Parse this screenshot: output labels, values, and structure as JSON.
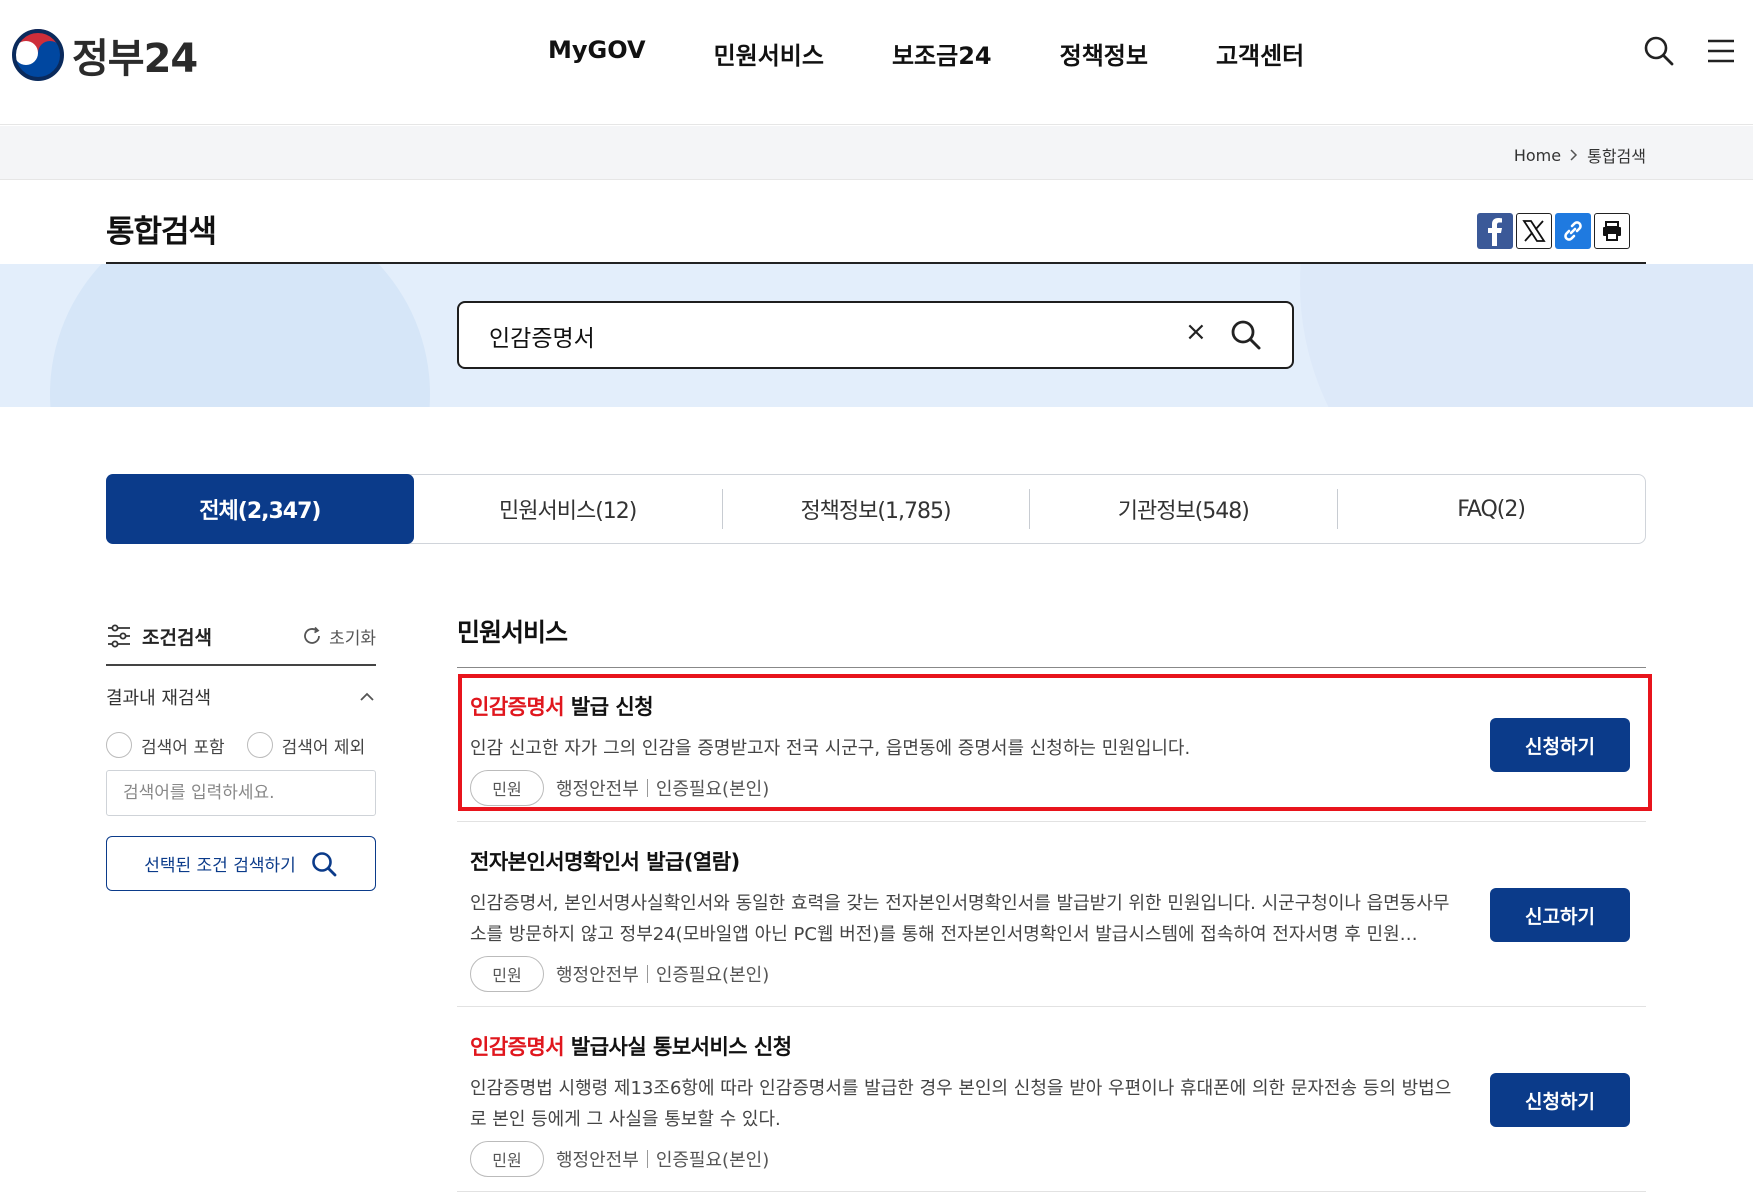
{
  "header": {
    "logo_text": "정부24",
    "nav": [
      "MyGOV",
      "민원서비스",
      "보조금24",
      "정책정보",
      "고객센터"
    ],
    "icons": [
      "search-icon",
      "menu-icon"
    ]
  },
  "breadcrumb": {
    "home": "Home",
    "current": "통합검색"
  },
  "page": {
    "title": "통합검색"
  },
  "share": {
    "icons": [
      "facebook-icon",
      "x-icon",
      "link-icon",
      "print-icon"
    ]
  },
  "search": {
    "value": "인감증명서",
    "clear": "×"
  },
  "tabs": [
    {
      "label": "전체(2,347)",
      "active": true
    },
    {
      "label": "민원서비스(12)",
      "active": false
    },
    {
      "label": "정책정보(1,785)",
      "active": false
    },
    {
      "label": "기관정보(548)",
      "active": false
    },
    {
      "label": "FAQ(2)",
      "active": false
    }
  ],
  "sidebar": {
    "title": "조건검색",
    "reset": "초기화",
    "refine_label": "결과내 재검색",
    "include": "검색어 포함",
    "exclude": "검색어 제외",
    "placeholder": "검색어를 입력하세요.",
    "submit": "선택된 조건 검색하기"
  },
  "section": {
    "title": "민원서비스"
  },
  "results": [
    {
      "title_highlight": "인감증명서",
      "title_rest": " 발급 신청",
      "desc": "인감 신고한 자가 그의 인감을 증명받고자 전국 시군구, 읍면동에 증명서를 신청하는 민원입니다.",
      "chip": "민원",
      "agency": "행정안전부",
      "auth": "인증필요(본인)",
      "button": "신청하기"
    },
    {
      "title_highlight": "",
      "title_rest": "전자본인서명확인서 발급(열람)",
      "desc": "인감증명서, 본인서명사실확인서와 동일한 효력을 갖는 전자본인서명확인서를 발급받기 위한 민원입니다. 시군구청이나 읍면동사무소를 방문하지 않고 정부24(모바일앱 아닌 PC웹 버전)를 통해 전자본인서명확인서 발급시스템에 접속하여 전자서명 후 민원…",
      "chip": "민원",
      "agency": "행정안전부",
      "auth": "인증필요(본인)",
      "button": "신고하기"
    },
    {
      "title_highlight": "인감증명서",
      "title_rest": " 발급사실 통보서비스 신청",
      "desc": "인감증명법 시행령 제13조6항에 따라 인감증명서를 발급한 경우 본인의 신청을 받아 우편이나 휴대폰에 의한 문자전송 등의 방법으로 본인 등에게 그 사실을 통보할 수 있다.",
      "chip": "민원",
      "agency": "행정안전부",
      "auth": "인증필요(본인)",
      "button": "신청하기"
    }
  ],
  "colors": {
    "primary": "#0b3b8a",
    "highlight": "#e0161d",
    "band": "#e3eefb"
  }
}
